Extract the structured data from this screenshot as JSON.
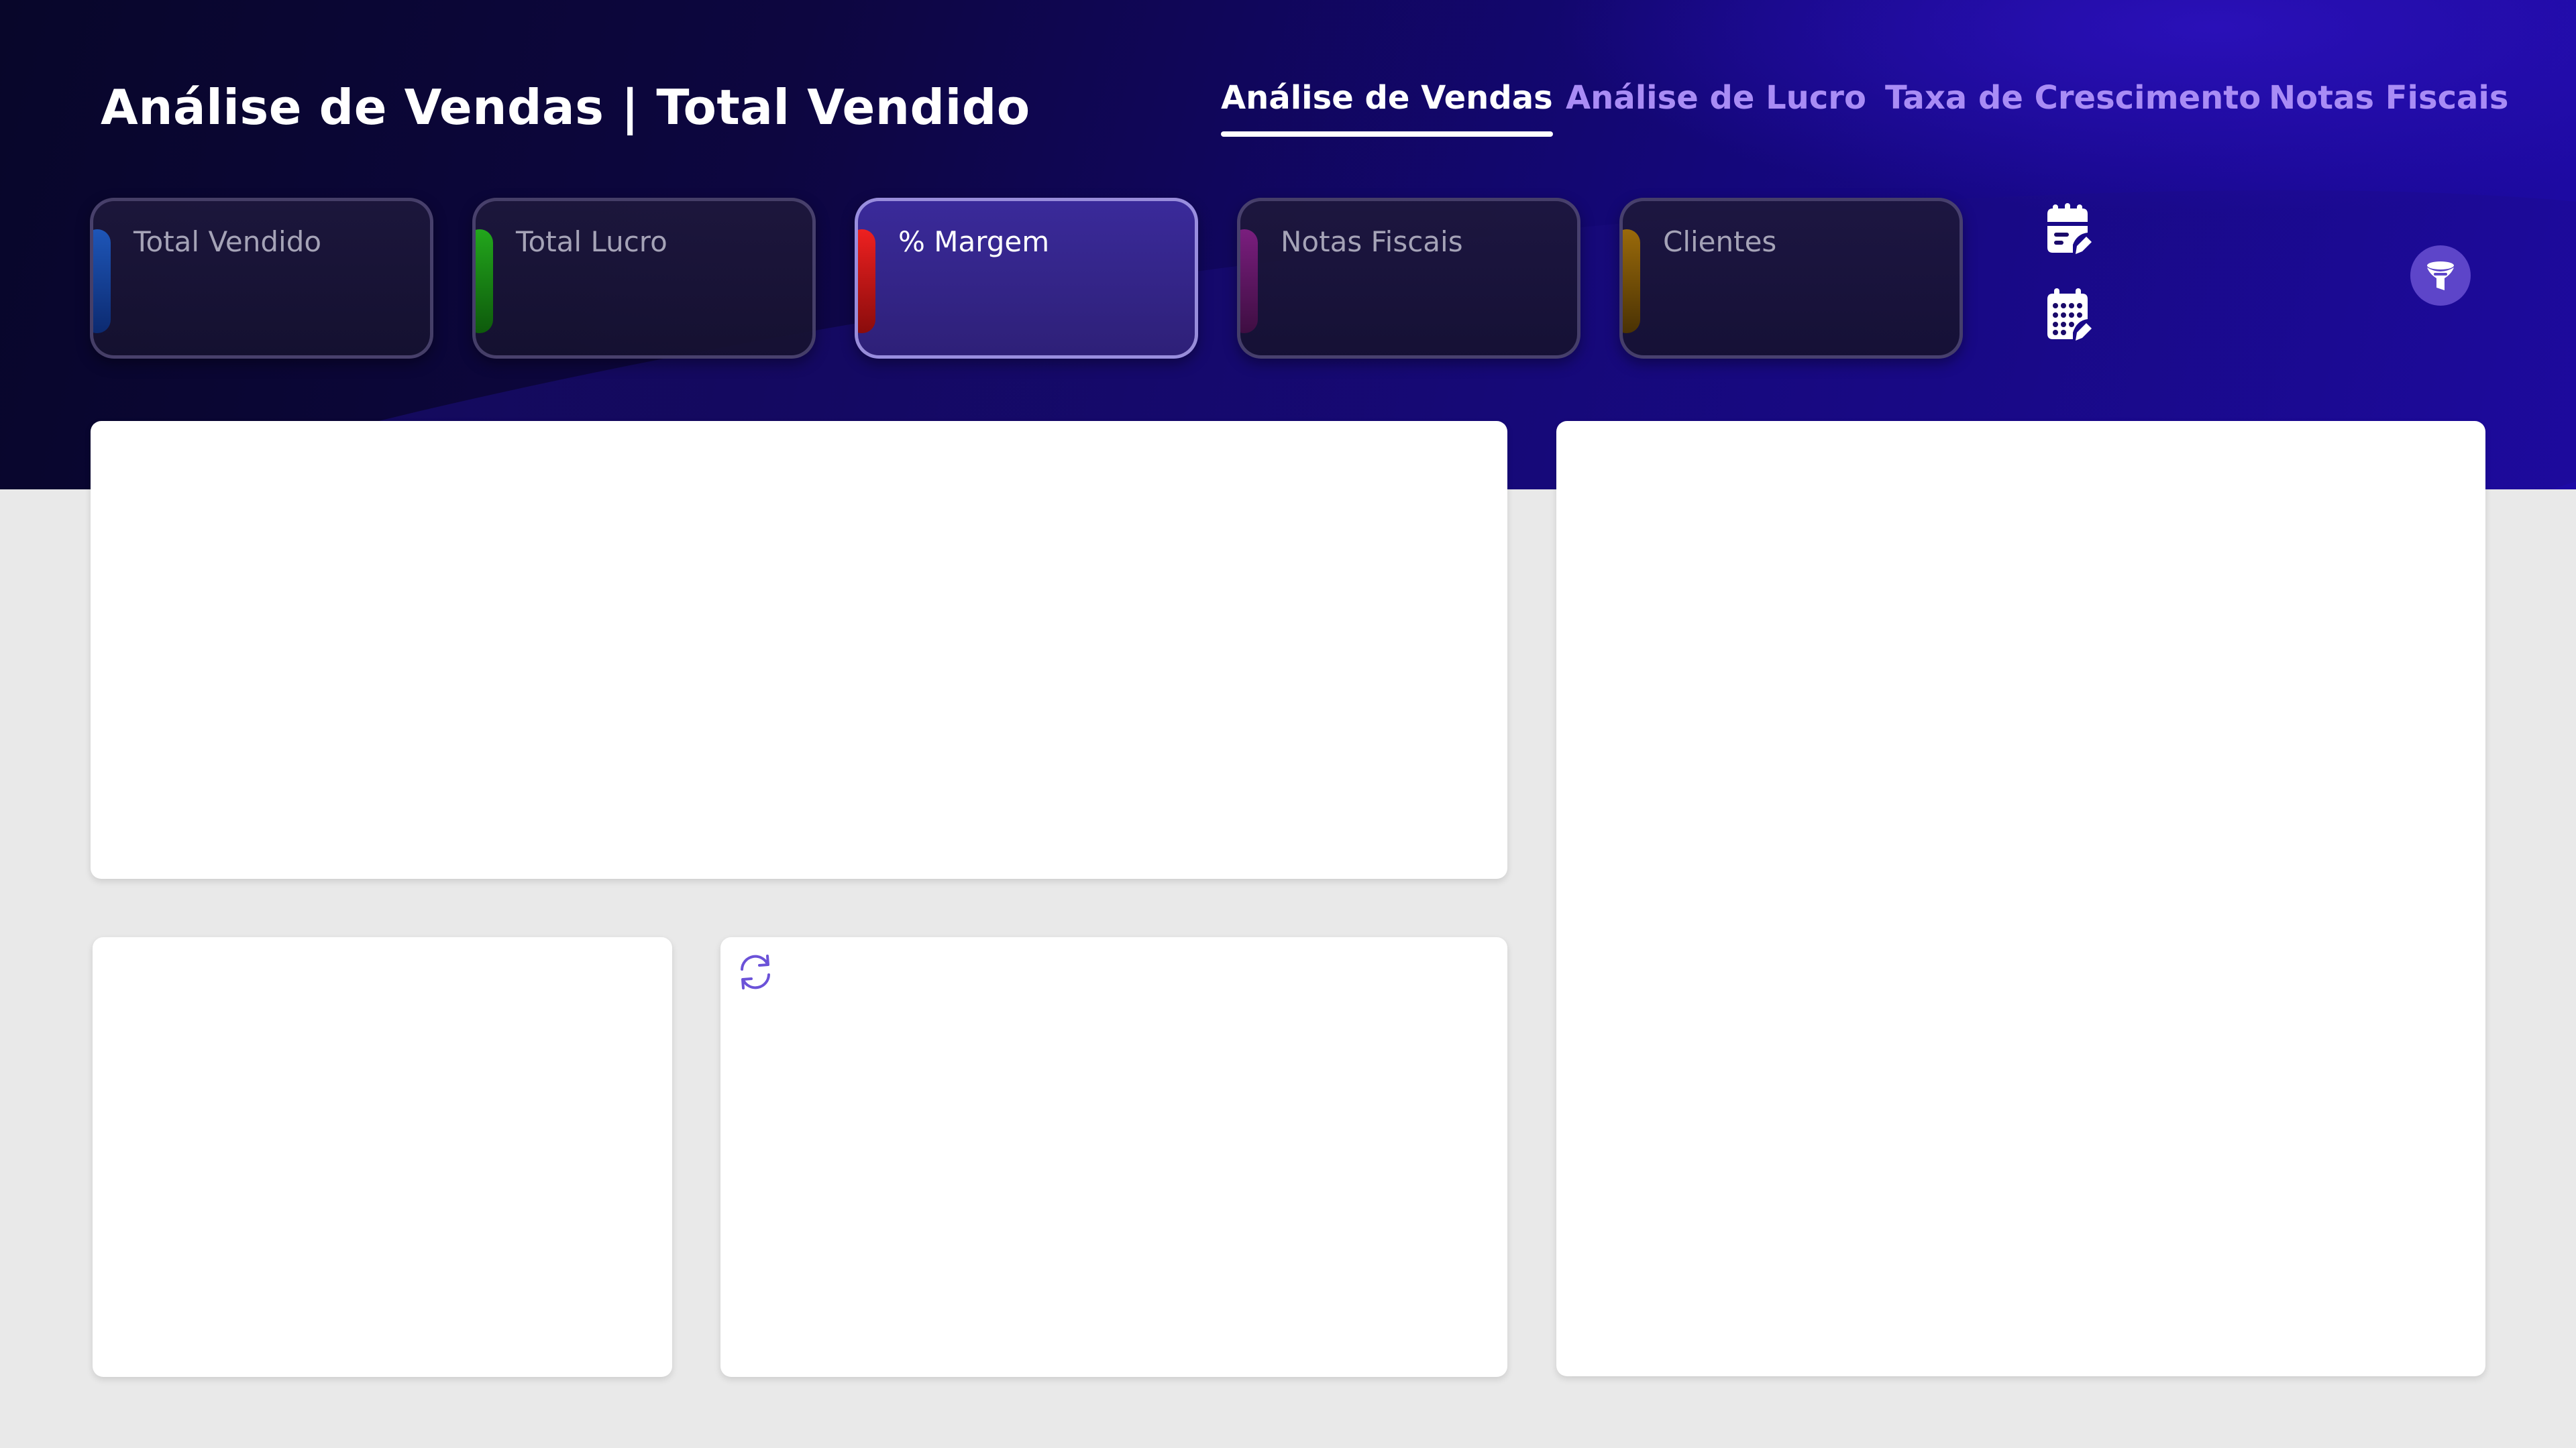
{
  "header": {
    "title": "Análise de Vendas | Total Vendido"
  },
  "nav": {
    "tabs": [
      {
        "label": "Análise de Vendas",
        "active": true
      },
      {
        "label": "Análise de Lucro",
        "active": false
      },
      {
        "label": "Taxa de Crescimento",
        "active": false
      },
      {
        "label": "Notas Fiscais",
        "active": false
      }
    ]
  },
  "kpis": [
    {
      "label": "Total Vendido",
      "accent": "#1e56b8",
      "active": false
    },
    {
      "label": "Total Lucro",
      "accent": "#22a61c",
      "active": false
    },
    {
      "label": "% Margem",
      "accent": "#d81818",
      "active": true
    },
    {
      "label": "Notas Fiscais",
      "accent": "#6b1a6e",
      "active": false
    },
    {
      "label": "Clientes",
      "accent": "#8a5a08",
      "active": false
    }
  ],
  "icons": {
    "calendar_edit": "calendar-edit-icon",
    "calendar_grid": "calendar-grid-icon",
    "filter": "filter-icon",
    "refresh": "refresh-icon"
  },
  "colors": {
    "header_bg": "#0d0640",
    "accent": "#5d45c9",
    "tab_inactive": "#a98cf5",
    "page_bg": "#e9e9e9"
  }
}
